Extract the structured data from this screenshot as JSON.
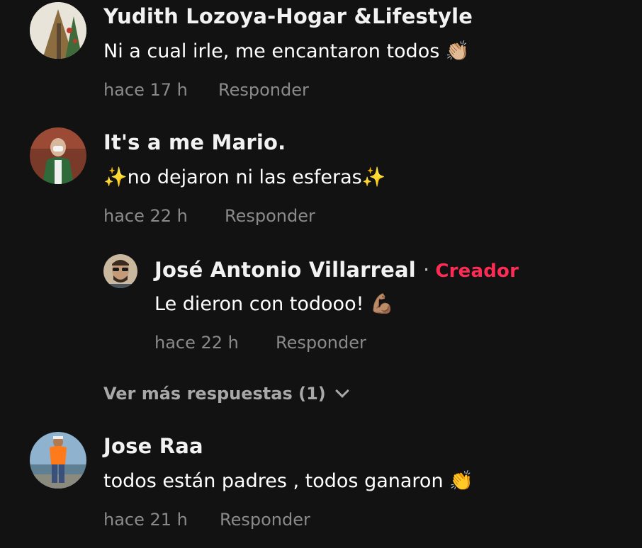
{
  "comments": [
    {
      "username": "Yudith Lozoya-Hogar &Lifestyle",
      "text": "Ni a cual irle, me encantaron todos 👏🏼",
      "time": "hace 17 h",
      "reply_label": "Responder"
    },
    {
      "username": "It's a me Mario.",
      "text": "✨no dejaron ni las esferas✨",
      "time": "hace 22 h",
      "reply_label": "Responder",
      "replies": [
        {
          "username": "José Antonio Villarreal",
          "separator": "·",
          "badge": "Creador",
          "text": "Le dieron con todooo! 💪🏽",
          "time": "hace 22 h",
          "reply_label": "Responder"
        }
      ],
      "more_replies_label": "Ver más respuestas (1)"
    },
    {
      "username": "Jose Raa",
      "text": "todos están padres , todos ganaron 👏",
      "time": "hace 21 h",
      "reply_label": "Responder"
    }
  ],
  "colors": {
    "background": "#121212",
    "creator_badge": "#fe2c55",
    "meta_text": "#8a8a8a"
  }
}
